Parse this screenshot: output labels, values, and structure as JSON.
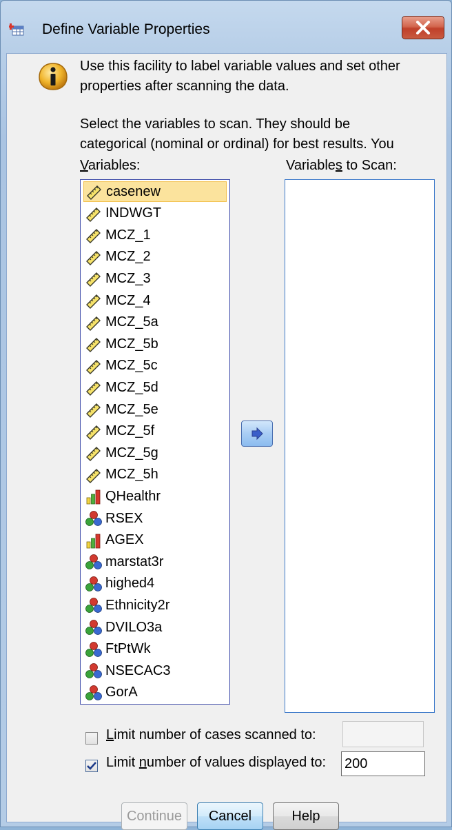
{
  "window": {
    "title": "Define Variable Properties"
  },
  "info": {
    "line1": "Use this facility to label variable values and set other",
    "line2": "properties after scanning the data."
  },
  "instructions": {
    "line1": "Select the variables to scan. They should be",
    "line2": "categorical (nominal or ordinal) for best results. You"
  },
  "variables_label": {
    "underline": "V",
    "rest": "ariables:"
  },
  "scan_label": {
    "before": "Variable",
    "underline": "s",
    "after": " to Scan:"
  },
  "variables": [
    {
      "name": "casenew",
      "type": "scale",
      "selected": true
    },
    {
      "name": "INDWGT",
      "type": "scale"
    },
    {
      "name": "MCZ_1",
      "type": "scale"
    },
    {
      "name": "MCZ_2",
      "type": "scale"
    },
    {
      "name": "MCZ_3",
      "type": "scale"
    },
    {
      "name": "MCZ_4",
      "type": "scale"
    },
    {
      "name": "MCZ_5a",
      "type": "scale"
    },
    {
      "name": "MCZ_5b",
      "type": "scale"
    },
    {
      "name": "MCZ_5c",
      "type": "scale"
    },
    {
      "name": "MCZ_5d",
      "type": "scale"
    },
    {
      "name": "MCZ_5e",
      "type": "scale"
    },
    {
      "name": "MCZ_5f",
      "type": "scale"
    },
    {
      "name": "MCZ_5g",
      "type": "scale"
    },
    {
      "name": "MCZ_5h",
      "type": "scale"
    },
    {
      "name": "QHealthr",
      "type": "ordinal"
    },
    {
      "name": "RSEX",
      "type": "nominal"
    },
    {
      "name": "AGEX",
      "type": "ordinal"
    },
    {
      "name": "marstat3r",
      "type": "nominal"
    },
    {
      "name": "highed4",
      "type": "nominal"
    },
    {
      "name": "Ethnicity2r",
      "type": "nominal"
    },
    {
      "name": "DVILO3a",
      "type": "nominal"
    },
    {
      "name": "FtPtWk",
      "type": "nominal"
    },
    {
      "name": "NSECAC3",
      "type": "nominal"
    },
    {
      "name": "GorA",
      "type": "nominal"
    }
  ],
  "limit_cases": {
    "underline": "L",
    "rest": "imit number of cases scanned to:",
    "checked": false,
    "value": ""
  },
  "limit_values": {
    "before": "Limit ",
    "underline": "n",
    "after": "umber of values displayed to:",
    "checked": true,
    "value": "200"
  },
  "buttons": {
    "continue": "Continue",
    "cancel": "Cancel",
    "help": "Help"
  },
  "colors": {
    "selection": "#fbe39d",
    "list_border": "#3b48a8",
    "close_button": "#c8533c"
  }
}
